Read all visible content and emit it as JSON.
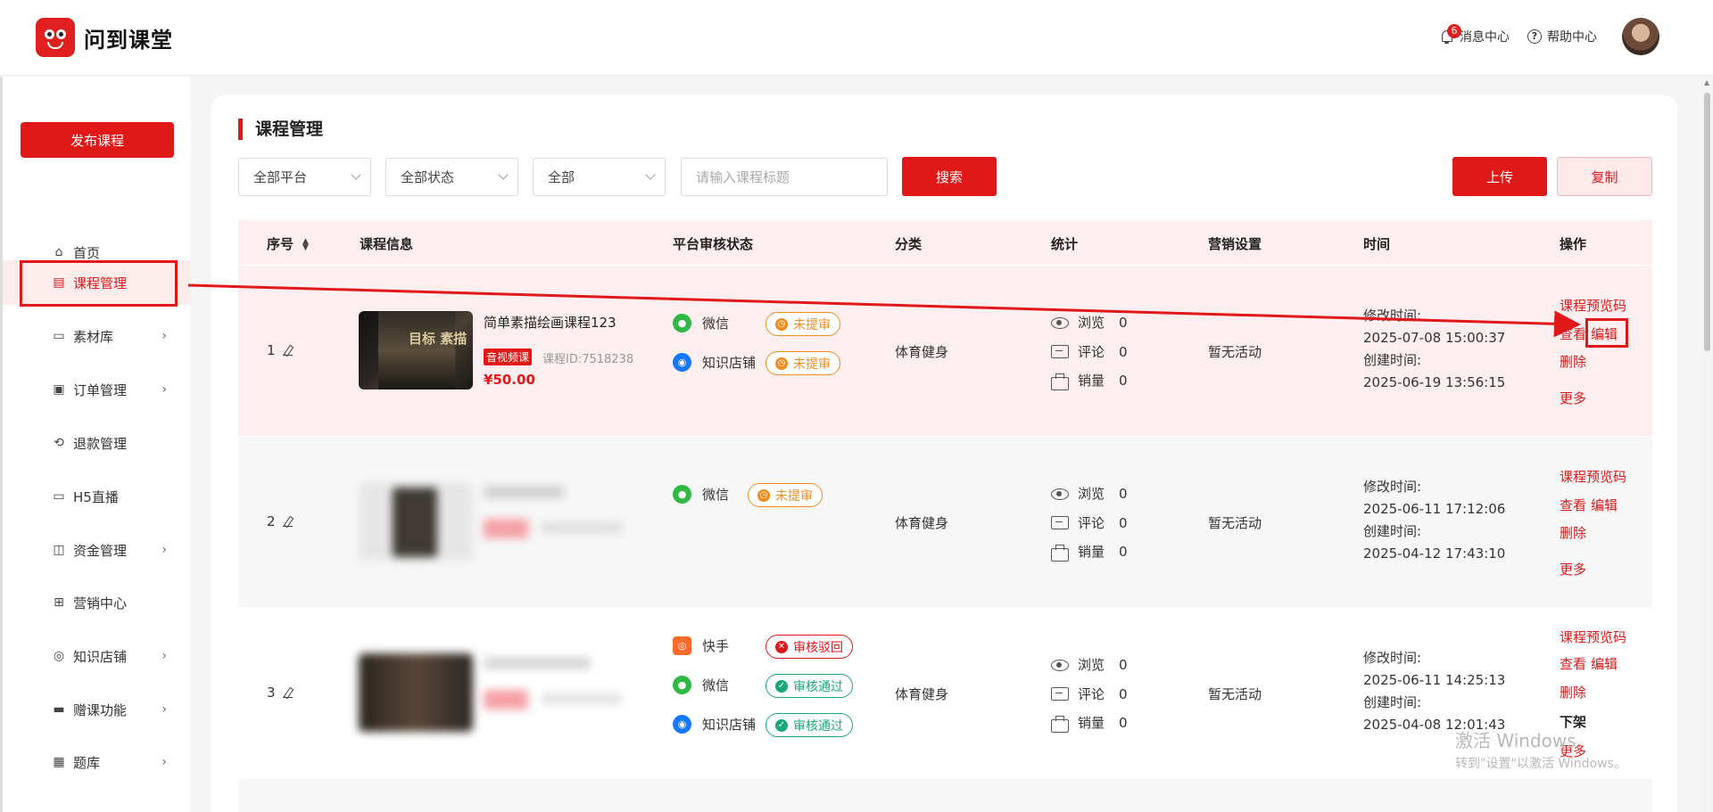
{
  "app": {
    "name": "问到课堂"
  },
  "header": {
    "messages_label": "消息中心",
    "messages_count": "6",
    "help_label": "帮助中心"
  },
  "sidebar": {
    "publish_label": "发布课程",
    "items": [
      {
        "label": "首页",
        "icon": "home-icon",
        "chevron": false
      },
      {
        "label": "课程管理",
        "icon": "course-icon",
        "chevron": false,
        "active": true
      },
      {
        "label": "素材库",
        "icon": "folder-icon",
        "chevron": true
      },
      {
        "label": "订单管理",
        "icon": "order-icon",
        "chevron": true
      },
      {
        "label": "退款管理",
        "icon": "refund-icon",
        "chevron": false
      },
      {
        "label": "H5直播",
        "icon": "video-icon",
        "chevron": false
      },
      {
        "label": "资金管理",
        "icon": "wallet-icon",
        "chevron": true
      },
      {
        "label": "营销中心",
        "icon": "gift-icon",
        "chevron": false
      },
      {
        "label": "知识店铺",
        "icon": "shop-icon",
        "chevron": true
      },
      {
        "label": "赠课功能",
        "icon": "gift-course-icon",
        "chevron": true
      },
      {
        "label": "题库",
        "icon": "question-bank-icon",
        "chevron": true
      }
    ]
  },
  "page": {
    "title": "课程管理",
    "filters": {
      "platform": "全部平台",
      "status": "全部状态",
      "all": "全部",
      "search_placeholder": "请输入课程标题"
    },
    "search_label": "搜索",
    "upload_label": "上传",
    "copy_label": "复制"
  },
  "table": {
    "headers": {
      "index": "序号",
      "info": "课程信息",
      "audit": "平台审核状态",
      "category": "分类",
      "stats": "统计",
      "marketing": "营销设置",
      "time": "时间",
      "ops": "操作"
    },
    "stat_labels": {
      "views": "浏览",
      "comments": "评论",
      "sales": "销量"
    },
    "time_labels": {
      "modified": "修改时间:",
      "created": "创建时间:"
    },
    "op_labels": {
      "preview": "课程预览码",
      "view": "查看",
      "edit": "编辑",
      "delete": "删除",
      "more": "更多",
      "offline": "下架"
    },
    "rows": [
      {
        "index": "1",
        "title": "简单素描绘画课程123",
        "tag": "音视频课",
        "course_id": "课程ID:7518238",
        "price": "¥50.00",
        "thumb_text": "目标 素描",
        "platforms": [
          {
            "name": "微信",
            "icon": "wechat-icon",
            "status": "未提审",
            "kind": "orange"
          },
          {
            "name": "知识店铺",
            "icon": "shop-platform-icon",
            "status": "未提审",
            "kind": "orange"
          }
        ],
        "category": "体育健身",
        "views": "0",
        "comments": "0",
        "sales": "0",
        "marketing": "暂无活动",
        "modified": "2025-07-08 15:00:37",
        "created": "2025-06-19 13:56:15"
      },
      {
        "index": "2",
        "platforms": [
          {
            "name": "微信",
            "icon": "wechat-icon",
            "status": "未提审",
            "kind": "orange"
          }
        ],
        "category": "体育健身",
        "views": "0",
        "comments": "0",
        "sales": "0",
        "marketing": "暂无活动",
        "modified": "2025-06-11 17:12:06",
        "created": "2025-04-12 17:43:10"
      },
      {
        "index": "3",
        "platforms": [
          {
            "name": "快手",
            "icon": "kuaishou-icon",
            "status": "审核驳回",
            "kind": "red"
          },
          {
            "name": "微信",
            "icon": "wechat-icon",
            "status": "审核通过",
            "kind": "green"
          },
          {
            "name": "知识店铺",
            "icon": "shop-platform-icon",
            "status": "审核通过",
            "kind": "green"
          }
        ],
        "category": "体育健身",
        "views": "0",
        "comments": "0",
        "sales": "0",
        "marketing": "暂无活动",
        "modified": "2025-06-11 14:25:13",
        "created": "2025-04-08 12:01:43"
      }
    ]
  },
  "watermark": {
    "line1": "激活 Windows",
    "line2": "转到\"设置\"以激活 Windows。"
  },
  "colors": {
    "accent": "#e01818",
    "orange": "#f08c1e",
    "green": "#1aa878"
  }
}
